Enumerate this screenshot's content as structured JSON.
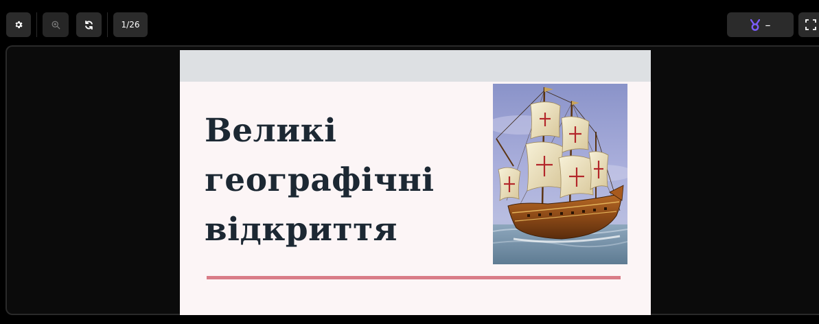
{
  "toolbar": {
    "settings_icon": "gear-icon",
    "zoom_icon": "zoom-in-icon",
    "refresh_icon": "refresh-icon",
    "page_counter": "1/26",
    "badge_icon": "medal-icon",
    "badge_value": "–",
    "badge_color": "#7b5cff",
    "fullscreen_icon": "fullscreen-icon"
  },
  "slide": {
    "title_lines": [
      "Великі",
      "географічні",
      "відкриття"
    ],
    "image": "sailing-ship-illustration",
    "colors": {
      "background": "#fcf5f6",
      "top_bar": "#dde0e3",
      "title": "#1c2833",
      "underline": "#d97c87"
    }
  }
}
